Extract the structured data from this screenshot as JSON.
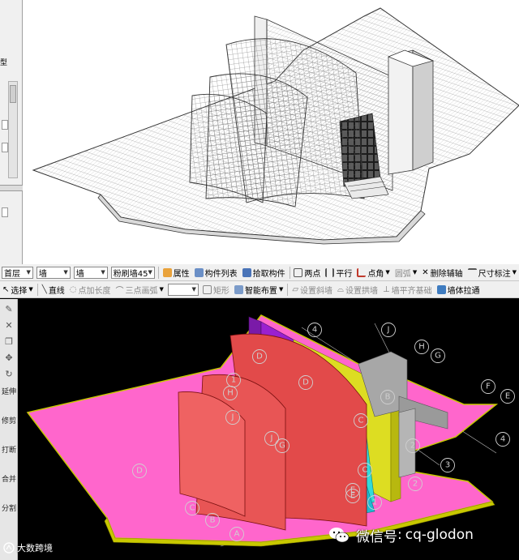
{
  "top_panel": {
    "left_strip": {
      "label": "型"
    }
  },
  "toolbar_1": {
    "floor_select": "首层",
    "type_select_1": "墙",
    "type_select_2": "墙",
    "component_select": "粉刷墙45",
    "properties": "属性",
    "component_list": "构件列表",
    "pick_component": "拾取构件",
    "two_points": "两点",
    "parallel": "平行",
    "point_angle": "点角",
    "arc": "圆弧",
    "delete_aux_axis": "删除辅轴",
    "dimension": "尺寸标注"
  },
  "toolbar_2": {
    "select": "选择",
    "line": "直线",
    "point_add_length": "点加长度",
    "three_point_arc": "三点画弧",
    "rectangle": "矩形",
    "smart_layout": "智能布置",
    "set_slope_wall": "设置斜墙",
    "set_arch_wall": "设置拱墙",
    "align_wall_base": "墙平齐基础",
    "wall_stretch": "墙体拉通"
  },
  "left_tools": {
    "extend": "延伸",
    "trim": "修剪",
    "break": "打断",
    "merge": "合并",
    "split": "分割"
  },
  "axis_labels": {
    "letters": [
      "A",
      "B",
      "C",
      "D",
      "C",
      "D",
      "E",
      "F",
      "G",
      "H",
      "J",
      "E",
      "J",
      "H",
      "G",
      "J",
      "D",
      "C",
      "B",
      "E"
    ],
    "numbers": [
      "1",
      "2",
      "3",
      "4",
      "4",
      "1",
      "2"
    ]
  },
  "watermark": {
    "prefix": "微信号",
    "colon": ":",
    "account": "cq-glodon"
  },
  "brand": {
    "name": "大数跨境"
  },
  "colors": {
    "floor_pink": "#ff66cc",
    "shell_red": "#e24a4a",
    "wall_purple": "#9a20d0",
    "wall_yellow": "#dddd22",
    "stair_gray": "#a7a7a7",
    "glass_cyan": "#33d9d9",
    "slab_edge_yellow": "#c8c800"
  },
  "icons": [
    "wechat-icon",
    "brand-logo-icon",
    "select-arrow-icon",
    "line-icon",
    "arc-icon",
    "properties-icon",
    "list-icon",
    "pick-icon",
    "two-point-icon",
    "parallel-icon",
    "angle-icon",
    "delete-axis-icon",
    "dimension-icon",
    "rectangle-icon",
    "smart-icon",
    "slope-wall-icon",
    "arch-wall-icon",
    "align-icon",
    "stretch-icon"
  ]
}
